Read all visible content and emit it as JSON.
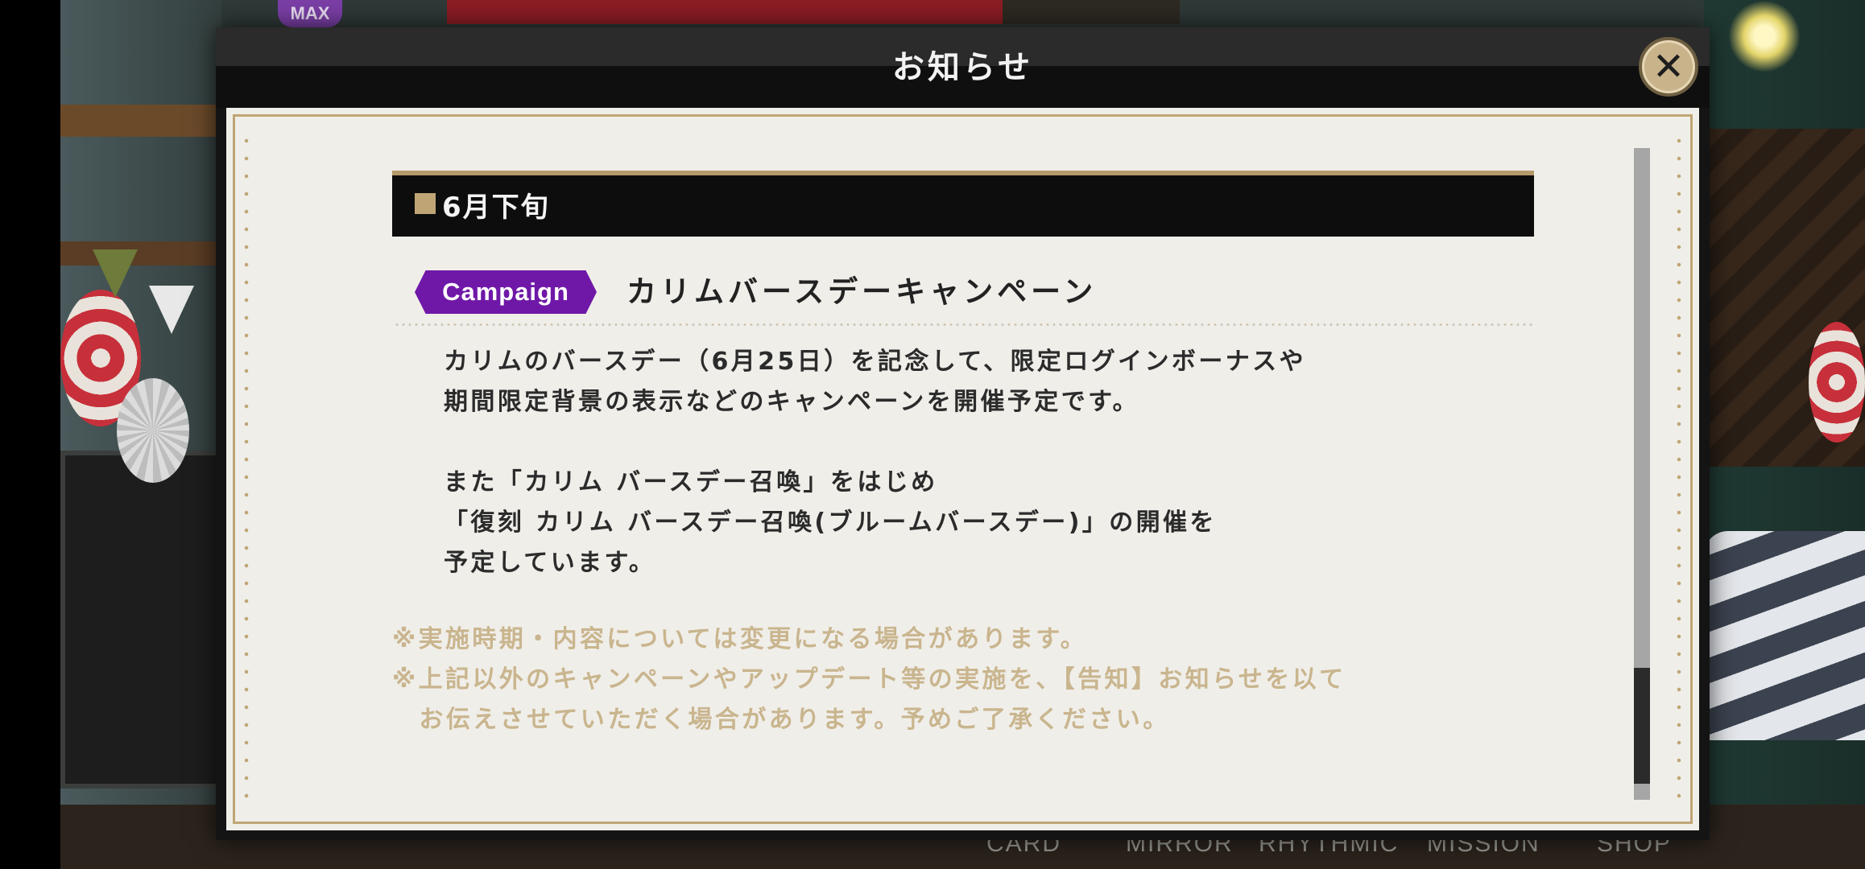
{
  "background": {
    "max_badge": "MAX",
    "bottom_menu": [
      "CARD",
      "MIRROR",
      "RHYTHMIC",
      "MISSION",
      "SHOP"
    ]
  },
  "dialog": {
    "title": "お知らせ",
    "close_icon": "close-icon",
    "section_header": "6月下旬",
    "item": {
      "badge": "Campaign",
      "badge_color": "#6f18a8",
      "title": "カリムバースデーキャンペーン"
    },
    "body_lines": [
      "カリムのバースデー（6月25日）を記念して、限定ログインボーナスや",
      "期間限定背景の表示などのキャンペーンを開催予定です。",
      "また「カリム バースデー召喚」をはじめ",
      "「復刻 カリム バースデー召喚(ブルームバースデー)」の開催を",
      "予定しています。"
    ],
    "notes": [
      "※実施時期・内容については変更になる場合があります。",
      "※上記以外のキャンペーンやアップデート等の実施を、【告知】お知らせを以て",
      "　お伝えさせていただく場合があります。予めご了承ください。"
    ],
    "accent_color": "#bfa575",
    "scroll_position": 0.85
  }
}
